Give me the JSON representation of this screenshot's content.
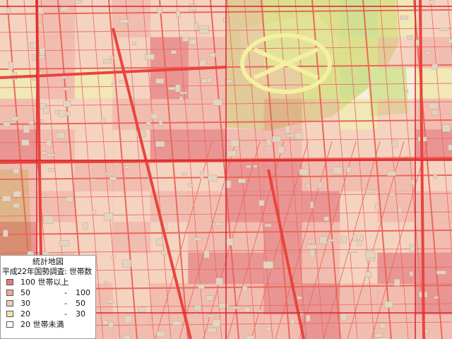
{
  "legend": {
    "title": "統計地図",
    "subtitle": "平成22年国勢調査: 世帯数",
    "classes": [
      {
        "label_low": "100 世帯以上",
        "label_high": "",
        "color": "#e8787a"
      },
      {
        "label_low": "50",
        "label_high": "100",
        "color": "#f3a99c"
      },
      {
        "label_low": "30",
        "label_high": "50",
        "color": "#f6c7b8"
      },
      {
        "label_low": "20",
        "label_high": "30",
        "color": "#efe6a3"
      },
      {
        "label_low": "20 世帯未満",
        "label_high": "",
        "color": "#ffffff"
      }
    ],
    "dash": "-"
  },
  "colors": {
    "park": "#c9dd86",
    "road_major": "#e8453c",
    "grid_line": "#d7232f",
    "base": "#f3efe4"
  }
}
